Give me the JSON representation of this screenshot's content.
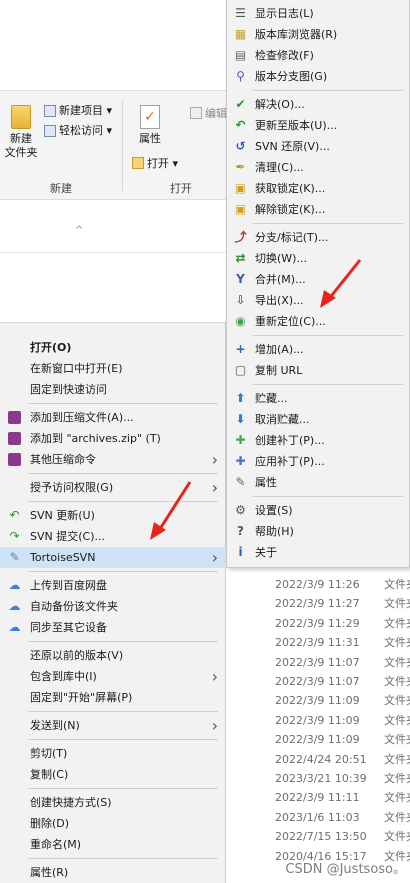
{
  "ribbon": {
    "new_folder": "新建\n文件夹",
    "new_item": "新建项目 ▾",
    "easy_access": "轻松访问 ▾",
    "group_new": "新建",
    "properties": "属性",
    "open": "打开 ▾",
    "group_open": "打开",
    "edit": "编辑"
  },
  "main_menu": [
    {
      "label": "打开(O)",
      "bold": true
    },
    {
      "label": "在新窗口中打开(E)"
    },
    {
      "label": "固定到快速访问"
    },
    {
      "sep": true
    },
    {
      "label": "添加到压缩文件(A)...",
      "icon": "winrar-icon"
    },
    {
      "label": "添加到 \"archives.zip\" (T)",
      "icon": "winrar-icon"
    },
    {
      "label": "其他压缩命令",
      "icon": "winrar-icon",
      "arrow": true
    },
    {
      "sep": true
    },
    {
      "label": "授予访问权限(G)",
      "arrow": true
    },
    {
      "sep": true
    },
    {
      "label": "SVN 更新(U)",
      "icon": "svn-update-icon"
    },
    {
      "label": "SVN 提交(C)...",
      "icon": "svn-commit-icon"
    },
    {
      "label": "TortoiseSVN",
      "icon": "tortoisesvn-icon",
      "arrow": true,
      "highlight": true
    },
    {
      "sep": true
    },
    {
      "label": "上传到百度网盘",
      "icon": "baidu-cloud-icon"
    },
    {
      "label": "自动备份该文件夹",
      "icon": "baidu-cloud-icon"
    },
    {
      "label": "同步至其它设备",
      "icon": "baidu-cloud-icon"
    },
    {
      "sep": true
    },
    {
      "label": "还原以前的版本(V)"
    },
    {
      "label": "包含到库中(I)",
      "arrow": true
    },
    {
      "label": "固定到\"开始\"屏幕(P)"
    },
    {
      "sep": true
    },
    {
      "label": "发送到(N)",
      "arrow": true
    },
    {
      "sep": true
    },
    {
      "label": "剪切(T)"
    },
    {
      "label": "复制(C)"
    },
    {
      "sep": true
    },
    {
      "label": "创建快捷方式(S)"
    },
    {
      "label": "删除(D)"
    },
    {
      "label": "重命名(M)"
    },
    {
      "sep": true
    },
    {
      "label": "属性(R)"
    }
  ],
  "sub_menu": [
    {
      "label": "显示日志(L)",
      "icon": "log-icon"
    },
    {
      "label": "版本库浏览器(R)",
      "icon": "repo-browser-icon"
    },
    {
      "label": "检查修改(F)",
      "icon": "check-modifications-icon"
    },
    {
      "label": "版本分支图(G)",
      "icon": "revision-graph-icon"
    },
    {
      "sep": true
    },
    {
      "label": "解决(O)...",
      "icon": "resolve-icon"
    },
    {
      "label": "更新至版本(U)...",
      "icon": "update-revision-icon"
    },
    {
      "label": "SVN 还原(V)...",
      "icon": "revert-icon"
    },
    {
      "label": "清理(C)...",
      "icon": "cleanup-icon"
    },
    {
      "label": "获取锁定(K)...",
      "icon": "lock-icon"
    },
    {
      "label": "解除锁定(K)...",
      "icon": "unlock-icon"
    },
    {
      "sep": true
    },
    {
      "label": "分支/标记(T)...",
      "icon": "branch-icon"
    },
    {
      "label": "切换(W)...",
      "icon": "switch-icon"
    },
    {
      "label": "合并(M)...",
      "icon": "merge-icon"
    },
    {
      "label": "导出(X)...",
      "icon": "export-icon"
    },
    {
      "label": "重新定位(C)...",
      "icon": "relocate-icon"
    },
    {
      "sep": true
    },
    {
      "label": "增加(A)...",
      "icon": "add-icon"
    },
    {
      "label": "复制 URL",
      "icon": "copy-url-icon"
    },
    {
      "sep": true
    },
    {
      "label": "贮藏...",
      "icon": "shelve-icon"
    },
    {
      "label": "取消贮藏...",
      "icon": "unshelve-icon"
    },
    {
      "label": "创建补丁(P)...",
      "icon": "create-patch-icon"
    },
    {
      "label": "应用补丁(P)...",
      "icon": "apply-patch-icon"
    },
    {
      "label": "属性",
      "icon": "properties-icon"
    },
    {
      "sep": true
    },
    {
      "label": "设置(S)",
      "icon": "settings-icon"
    },
    {
      "label": "帮助(H)",
      "icon": "help-icon"
    },
    {
      "label": "关于",
      "icon": "about-icon"
    }
  ],
  "files": [
    {
      "date": "2022/3/9 11:26",
      "type": "文件夹"
    },
    {
      "date": "2022/3/9 11:27",
      "type": "文件夹"
    },
    {
      "date": "2022/3/9 11:29",
      "type": "文件夹"
    },
    {
      "date": "2022/3/9 11:31",
      "type": "文件夹"
    },
    {
      "date": "2022/3/9 11:07",
      "type": "文件夹"
    },
    {
      "date": "2022/3/9 11:07",
      "type": "文件夹"
    },
    {
      "date": "2022/3/9 11:09",
      "type": "文件夹"
    },
    {
      "date": "2022/3/9 11:09",
      "type": "文件夹"
    },
    {
      "date": "2022/3/9 11:09",
      "type": "文件夹"
    },
    {
      "date": "2022/4/24 20:51",
      "type": "文件夹"
    },
    {
      "date": "2023/3/21 10:39",
      "type": "文件夹"
    },
    {
      "date": "2022/3/9 11:11",
      "type": "文件夹"
    },
    {
      "date": "2023/1/6 11:03",
      "type": "文件夹"
    },
    {
      "date": "2022/7/15 13:50",
      "type": "文件夹"
    },
    {
      "date": "2020/4/16 15:17",
      "type": "文件夹"
    }
  ],
  "watermark": "CSDN @Justsoso。",
  "colors": {
    "menu_bg": "#f2f2f2",
    "highlight": "#cfe3f7",
    "arrow_red": "#e8231c",
    "svn_green": "#2f8f2f"
  }
}
